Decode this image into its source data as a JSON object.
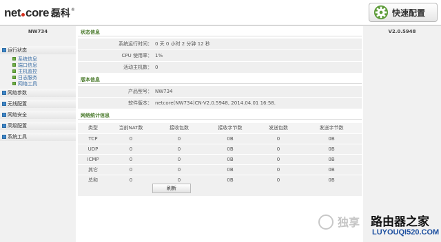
{
  "header": {
    "logo_text_left": "net",
    "logo_text_right": "core",
    "logo_cn": "磊科",
    "logo_reg": "®",
    "quick_config_label": "快速配置"
  },
  "sidebar": {
    "model": "NW734",
    "groups": [
      {
        "label": "运行状态",
        "items": [
          "系统信息",
          "端口信息",
          "主机监控",
          "日志服务",
          "网络工具"
        ]
      },
      {
        "label": "网络参数",
        "items": []
      },
      {
        "label": "无线配置",
        "items": []
      },
      {
        "label": "网络安全",
        "items": []
      },
      {
        "label": "高级配置",
        "items": []
      },
      {
        "label": "系统工具",
        "items": []
      }
    ]
  },
  "status": {
    "title": "状态信息",
    "rows": [
      {
        "key": "系统运行时间：",
        "value": "0 天 0 小时 2 分钟 12 秒"
      },
      {
        "key": "CPU 使用率：",
        "value": "1%"
      },
      {
        "key": "活动主机数：",
        "value": "0"
      }
    ]
  },
  "version_info": {
    "title": "版本信息",
    "rows": [
      {
        "key": "产品型号：",
        "value": "NW734"
      },
      {
        "key": "软件版本：",
        "value": "netcore(NW734)CN-V2.0.5948, 2014.04.01 16:58."
      }
    ]
  },
  "traffic": {
    "title": "网络统计信息",
    "columns": [
      "类型",
      "当前NAT数",
      "接收包数",
      "接收字节数",
      "发送包数",
      "发送字节数"
    ],
    "rows": [
      [
        "TCP",
        "0",
        "0",
        "0B",
        "0",
        "0B"
      ],
      [
        "UDP",
        "0",
        "0",
        "0B",
        "0",
        "0B"
      ],
      [
        "ICMP",
        "0",
        "0",
        "0B",
        "0",
        "0B"
      ],
      [
        "其它",
        "0",
        "0",
        "0B",
        "0",
        "0B"
      ],
      [
        "总和",
        "0",
        "0",
        "0B",
        "0",
        "0B"
      ]
    ],
    "refresh_label": "刷新"
  },
  "right": {
    "version": "V2.0.5948"
  },
  "watermark": {
    "ttl": "独享",
    "brand": "路由器之家",
    "url": "LUYOUQI520.COM"
  },
  "colors": {
    "section_title": "#4a7a2c",
    "menu_mark": "#3f86c8",
    "sub_bullet": "#6fae44",
    "sub_label": "#3a6ea5"
  }
}
